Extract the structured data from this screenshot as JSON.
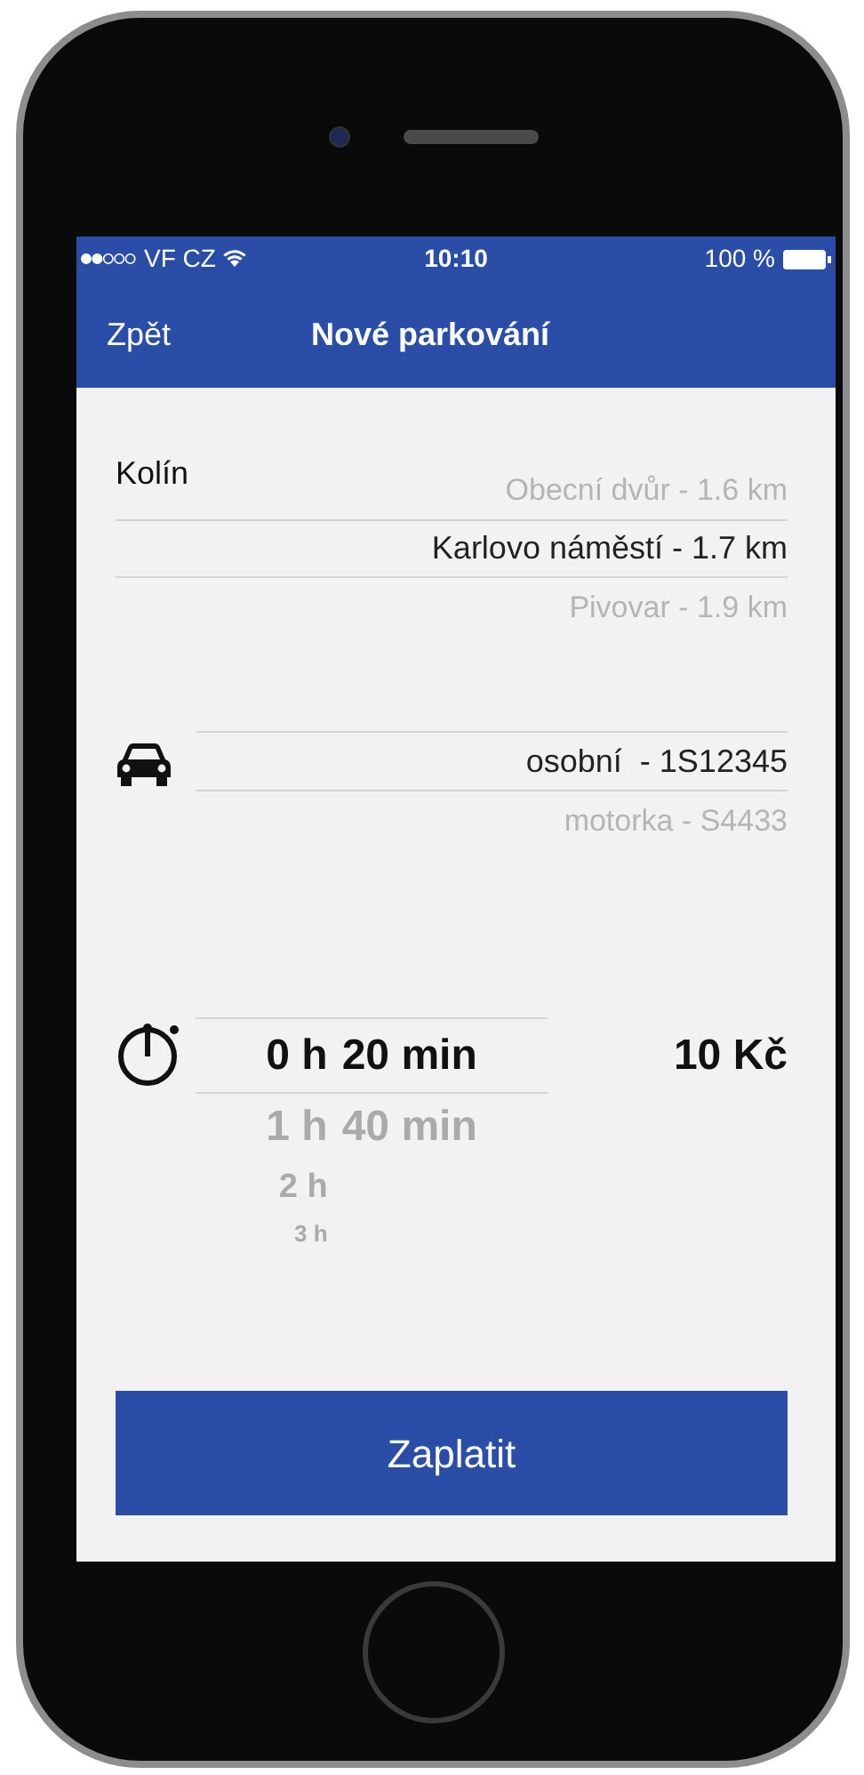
{
  "status_bar": {
    "carrier": "VF CZ",
    "time": "10:10",
    "battery": "100 %"
  },
  "nav_bar": {
    "back": "Zpět",
    "title": "Nové parkování"
  },
  "location": {
    "city": "Kolín",
    "options": [
      {
        "label": "Obecní dvůr - 1.6 km",
        "selected": false
      },
      {
        "label": "Karlovo náměstí - 1.7 km",
        "selected": true
      },
      {
        "label": "Pivovar - 1.9 km",
        "selected": false
      }
    ]
  },
  "vehicle": {
    "options": [
      {
        "label": "osobní  - 1S12345",
        "selected": true
      },
      {
        "label": "motorka - S4433",
        "selected": false
      }
    ]
  },
  "duration": {
    "hours": [
      {
        "label": "0 h",
        "selected": true
      },
      {
        "label": "1 h",
        "selected": false
      },
      {
        "label": "2 h",
        "selected": false
      },
      {
        "label": "3 h",
        "selected": false
      }
    ],
    "minutes": [
      {
        "label": "20 min",
        "selected": true
      },
      {
        "label": "40 min",
        "selected": false
      }
    ],
    "price": "10 Kč"
  },
  "pay_button": "Zaplatit"
}
